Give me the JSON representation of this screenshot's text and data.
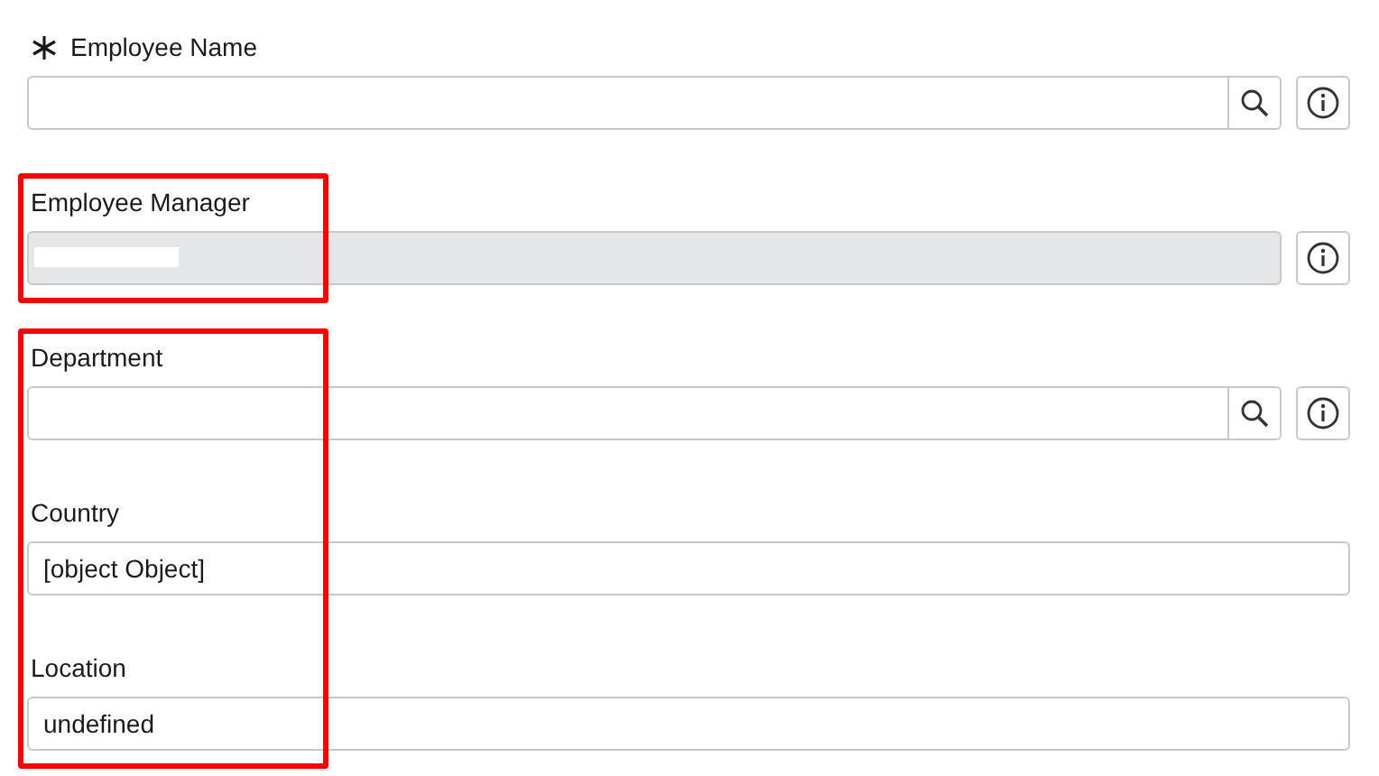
{
  "sections": [
    {
      "highlighted": false,
      "fields": [
        {
          "label": "Employee Name",
          "required": true,
          "readonly": false,
          "redacted": false,
          "lookup": true,
          "info": true
        }
      ]
    },
    {
      "highlighted": true,
      "fields": [
        {
          "label": "Employee Manager",
          "required": false,
          "readonly": true,
          "redacted": true,
          "lookup": false,
          "info": true
        }
      ]
    },
    {
      "highlighted": true,
      "fields": [
        {
          "label": "Department",
          "required": false,
          "readonly": false,
          "redacted": false,
          "lookup": true,
          "info": true
        },
        {
          "label": "Country",
          "required": false,
          "value": "[object Object]",
          "readonly": false,
          "redacted": false,
          "lookup": false,
          "info": false
        },
        {
          "label": "Location",
          "required": false,
          "value": "undefined",
          "readonly": false,
          "redacted": false,
          "lookup": false,
          "info": false
        }
      ]
    }
  ]
}
